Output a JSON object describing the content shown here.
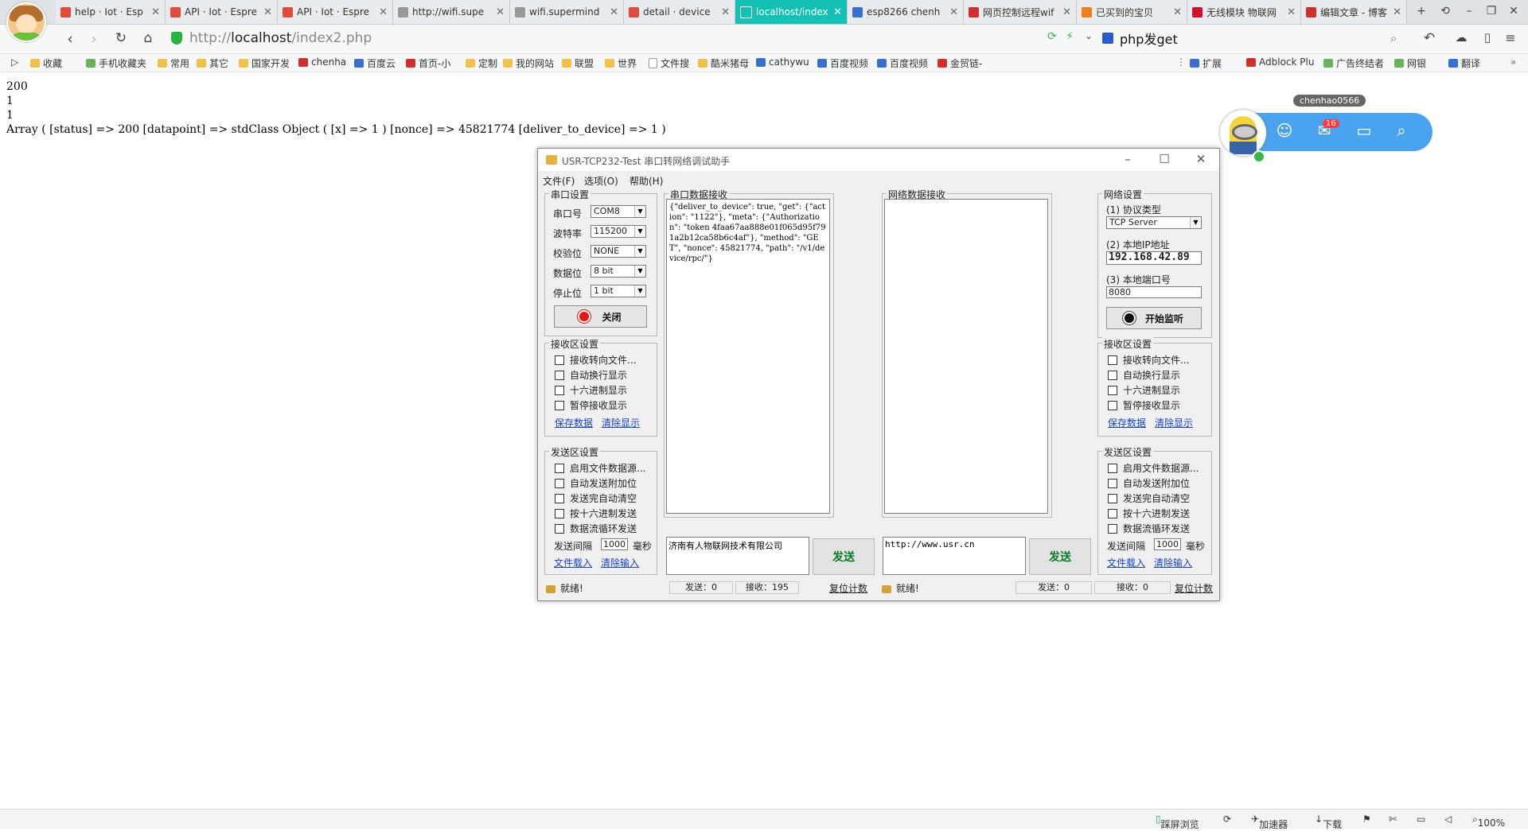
{
  "browser": {
    "tabs": [
      {
        "title": "help · Iot · Esp",
        "icon": "rss-icon",
        "color": "#e14b3b"
      },
      {
        "title": "API · Iot · Espre",
        "icon": "rss-icon",
        "color": "#e14b3b"
      },
      {
        "title": "API · Iot · Espre",
        "icon": "rss-icon",
        "color": "#e14b3b"
      },
      {
        "title": "http://wifi.supe",
        "icon": "page-icon",
        "color": "#999999"
      },
      {
        "title": "wifi.supermind",
        "icon": "page-icon",
        "color": "#999999"
      },
      {
        "title": "detail · device",
        "icon": "rss-icon",
        "color": "#e14b3b"
      },
      {
        "title": "localhost/index",
        "icon": "page-icon",
        "color": "#ffffff",
        "active": true
      },
      {
        "title": "esp8266 chenh",
        "icon": "image-icon",
        "color": "#3a6fd0"
      },
      {
        "title": "网页控制远程wif",
        "icon": "csdn-icon",
        "color": "#d0302c"
      },
      {
        "title": "已买到的宝贝",
        "icon": "taobao-icon",
        "color": "#f07c20"
      },
      {
        "title": "无线模块 物联网",
        "icon": "t-icon",
        "color": "#d0102c"
      },
      {
        "title": "编辑文章 - 博客",
        "icon": "csdn-icon",
        "color": "#d0302c"
      }
    ],
    "url_protocol": "http://",
    "url_host": "localhost",
    "url_path": "/index2.php",
    "search_text": "php发get",
    "bookmarks": [
      {
        "label": "收藏",
        "icon": "star-icon"
      },
      {
        "label": "手机收藏夹",
        "icon": "phone-icon"
      },
      {
        "label": "常用",
        "icon": "folder-icon"
      },
      {
        "label": "其它",
        "icon": "folder-icon"
      },
      {
        "label": "国家开发",
        "icon": "folder-icon"
      },
      {
        "label": "chenha",
        "icon": "csdn-icon"
      },
      {
        "label": "百度云",
        "icon": "cloud-icon"
      },
      {
        "label": "首页-小",
        "icon": "mi-icon"
      },
      {
        "label": "定制",
        "icon": "folder-icon"
      },
      {
        "label": "我的网站",
        "icon": "folder-icon"
      },
      {
        "label": "联盟",
        "icon": "folder-icon"
      },
      {
        "label": "世界",
        "icon": "folder-icon"
      },
      {
        "label": "文件搜",
        "icon": "page-icon"
      },
      {
        "label": "酷米猪母",
        "icon": "face-icon"
      },
      {
        "label": "cathywu",
        "icon": "y-icon"
      },
      {
        "label": "百度视频",
        "icon": "video-icon"
      },
      {
        "label": "百度视频",
        "icon": "video-icon"
      },
      {
        "label": "金贸链-",
        "icon": "chain-icon"
      }
    ],
    "bookmarks_right": [
      {
        "label": "扩展",
        "icon": "grid-icon"
      },
      {
        "label": "Adblock Plu",
        "icon": "adblock-icon"
      },
      {
        "label": "广告终结者",
        "icon": "shield-icon"
      },
      {
        "label": "网银",
        "icon": "bank-icon"
      },
      {
        "label": "翻译",
        "icon": "translate-icon"
      }
    ],
    "status_bar": {
      "safe_browse": "踩屏浏览",
      "accelerator": "加速器",
      "download": "下载",
      "zoom": "100%"
    }
  },
  "page": {
    "lines": [
      "200",
      "1",
      "1",
      "Array ( [status] => 200 [datapoint] => stdClass Object ( [x] => 1 ) [nonce] => 45821774 [deliver_to_device] => 1 )"
    ]
  },
  "widget": {
    "username": "chenhao0566",
    "mail_badge": "16"
  },
  "tool": {
    "title": "USR-TCP232-Test 串口转网络调试助手",
    "menu": [
      "文件(F)",
      "选项(O)",
      "帮助(H)"
    ],
    "serial_settings": {
      "title": "串口设置",
      "fields": [
        {
          "label": "串口号",
          "value": "COM8"
        },
        {
          "label": "波特率",
          "value": "115200"
        },
        {
          "label": "校验位",
          "value": "NONE"
        },
        {
          "label": "数据位",
          "value": "8 bit"
        },
        {
          "label": "停止位",
          "value": "1 bit"
        }
      ],
      "toggle_button": "关闭"
    },
    "recv_settings": {
      "title": "接收区设置",
      "options": [
        "接收转向文件...",
        "自动换行显示",
        "十六进制显示",
        "暂停接收显示"
      ],
      "save_link": "保存数据",
      "clear_link": "清除显示"
    },
    "send_settings": {
      "title": "发送区设置",
      "options": [
        "启用文件数据源...",
        "自动发送附加位",
        "发送完自动清空",
        "按十六进制发送",
        "数据流循环发送"
      ],
      "interval_label": "发送间隔",
      "interval_value": "1000",
      "interval_unit": "毫秒",
      "load_link": "文件载入",
      "clear_input_link": "清除输入"
    },
    "serial_recv": {
      "title": "串口数据接收",
      "text": "{\"deliver_to_device\": true, \"get\": {\"action\": \"1122\"}, \"meta\": {\"Authorization\": \"token 4faa67aa888e01f065d95f791a2b12ca58b6c4af\"}, \"method\": \"GET\", \"nonce\": 45821774, \"path\": \"/v1/device/rpc/\"}"
    },
    "serial_send_text": "济南有人物联网技术有限公司",
    "send_button": "发送",
    "network_recv": {
      "title": "网络数据接收",
      "text": ""
    },
    "network_send_text": "http://www.usr.cn",
    "network_settings": {
      "title": "网络设置",
      "protocol_label": "(1) 协议类型",
      "protocol_value": "TCP Server",
      "ip_label": "(2) 本地IP地址",
      "ip_value": "192.168.42.89",
      "port_label": "(3) 本地端口号",
      "port_value": "8080",
      "listen_button": "开始监听"
    },
    "status_left": {
      "ready": "就绪!",
      "sent": "发送：0",
      "received": "接收：195",
      "reset": "复位计数"
    },
    "status_right": {
      "ready": "就绪!",
      "sent": "发送：0",
      "received": "接收：0",
      "reset": "复位计数"
    }
  }
}
